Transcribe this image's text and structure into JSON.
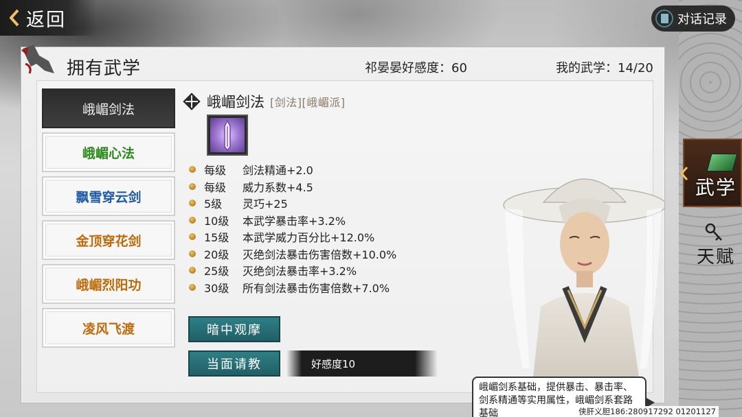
{
  "topbar": {
    "back_label": "返回",
    "dialog_log_label": "对话记录"
  },
  "panel": {
    "title": "拥有武学",
    "favor_label": "祁晏晏好感度：60",
    "my_wuxue_label": "我的武学：14/20"
  },
  "skills": [
    {
      "name": "峨嵋剑法",
      "color": "#eeeeee",
      "active": true
    },
    {
      "name": "峨嵋心法",
      "color": "#2c8a1c",
      "active": false
    },
    {
      "name": "飘雪穿云剑",
      "color": "#1e5aa8",
      "active": false
    },
    {
      "name": "金顶穿花剑",
      "color": "#c06a0a",
      "active": false
    },
    {
      "name": "峨嵋烈阳功",
      "color": "#c06a0a",
      "active": false
    },
    {
      "name": "凌风飞渡",
      "color": "#c06a0a",
      "active": false
    }
  ],
  "detail": {
    "name": "峨嵋剑法",
    "tags": "[剑法][峨嵋派]",
    "bonuses": [
      {
        "level": "每级",
        "text": "剑法精通+2.0"
      },
      {
        "level": "每级",
        "text": "威力系数+4.5"
      },
      {
        "level": "5级",
        "text": "灵巧+25"
      },
      {
        "level": "10级",
        "text": "本武学暴击率+3.2%"
      },
      {
        "level": "15级",
        "text": "本武学威力百分比+12.0%"
      },
      {
        "level": "20级",
        "text": "灭绝剑法暴击伤害倍数+10.0%"
      },
      {
        "level": "25级",
        "text": "灭绝剑法暴击率+3.2%"
      },
      {
        "level": "30级",
        "text": "所有剑法暴击伤害倍数+7.0%"
      }
    ],
    "observe_button": "暗中观摩",
    "ask_button": "当面请教",
    "favor_requirement": "好感度10"
  },
  "speech": {
    "text": "峨嵋剑系基础，提供暴击、暴击率、剑系精通等实用属性，峨嵋剑系套路基础"
  },
  "side_tabs": {
    "wuxue": "武学",
    "tianfu": "天赋"
  },
  "footer": {
    "id_text": "侠肝义胆186:280917292 01201127"
  }
}
